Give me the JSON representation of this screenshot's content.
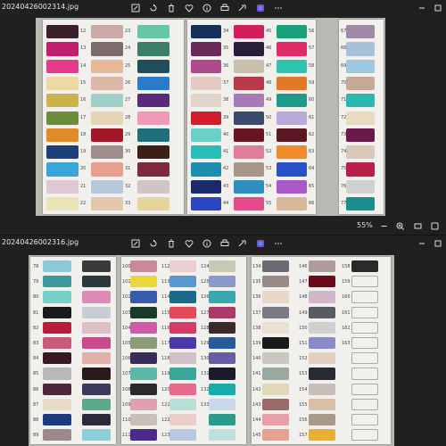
{
  "viewers": [
    {
      "filename": "20240426002314.jpg",
      "zoom": "55%",
      "toolbar_icons": [
        "edit-icon",
        "rotate-icon",
        "delete-icon",
        "favorite-icon",
        "info-icon",
        "print-icon",
        "share-icon",
        "copilot-icon",
        "more-icon"
      ],
      "cards": [
        {
          "columns": [
            {
              "numbers": [
                "12",
                "13",
                "14",
                "15",
                "16",
                "17",
                "18",
                "19",
                "20",
                "21",
                "22"
              ],
              "colors": [
                "#3a1f2c",
                "#c21e6e",
                "#e63a8c",
                "#ecd9a8",
                "#c9b34a",
                "#6c8e3a",
                "#e08a2a",
                "#1d3f7a",
                "#3aa6d8",
                "#dcc9d4",
                "#e9e4b5"
              ]
            },
            {
              "numbers": [
                "23",
                "24",
                "25",
                "26",
                "27",
                "28",
                "29",
                "30",
                "31",
                "32",
                "33"
              ],
              "colors": [
                "#caa9a6",
                "#7e6b6e",
                "#e9b79a",
                "#d9b8a8",
                "#9ed0c8",
                "#e6d3b6",
                "#a0182a",
                "#9e8f8a",
                "#e79f8f",
                "#b8c8d8",
                "#e0c8a8"
              ]
            },
            {
              "numbers": [
                "",
                "",
                "",
                "",
                "",
                "",
                "",
                "",
                "",
                "",
                ""
              ],
              "colors": [
                "#66c4a8",
                "#3b7f6a",
                "#1f4f5a",
                "#2a7cc8",
                "#5a2a7a",
                "#f09ab8",
                "#1e6f7a",
                "#3a2016",
                "#7a2a3a",
                "#cfc5c5",
                "#e6d59a"
              ]
            }
          ]
        },
        {
          "columns": [
            {
              "numbers": [
                "34",
                "35",
                "36",
                "37",
                "38",
                "39",
                "40",
                "41",
                "42",
                "43",
                "44"
              ],
              "colors": [
                "#14305a",
                "#6a2a5a",
                "#b04a8c",
                "#e4cbc2",
                "#e2d4cc",
                "#d01e2e",
                "#6ccfc8",
                "#2abcb6",
                "#1e8eb0",
                "#1a2a6a",
                "#2a46c0"
              ]
            },
            {
              "numbers": [
                "45",
                "46",
                "47",
                "48",
                "49",
                "50",
                "51",
                "52",
                "53",
                "54",
                "55"
              ],
              "colors": [
                "#d21e5a",
                "#2a1f3a",
                "#c8c0a8",
                "#b83a4a",
                "#a87ab8",
                "#3a4a6a",
                "#6a1622",
                "#e07e9a",
                "#a8968a",
                "#2e8ec0",
                "#e54a8a"
              ]
            },
            {
              "numbers": [
                "56",
                "57",
                "58",
                "59",
                "60",
                "61",
                "62",
                "63",
                "64",
                "65",
                "66"
              ],
              "colors": [
                "#1aa07a",
                "#e02a6a",
                "#2ec4b0",
                "#e07a2a",
                "#1e9a8a",
                "#b8aad8",
                "#5a1822",
                "#f08a2a",
                "#2a50c8",
                "#a858c8",
                "#d8b898"
              ]
            }
          ]
        },
        {
          "columns": [
            {
              "numbers": [
                "67",
                "68",
                "69",
                "70",
                "71",
                "72",
                "73",
                "74",
                "75",
                "76",
                "77"
              ],
              "colors": [
                "#9e8aa6",
                "#a8c0d8",
                "#9ec8e0",
                "#c4a898",
                "#2ab8b0",
                "#e8dcc0",
                "#6a1a4a",
                "#d8c8b8",
                "#b81e4a",
                "#cfd0d0",
                "#1a8e8e"
              ]
            }
          ]
        }
      ]
    },
    {
      "filename": "20240426002316.jpg",
      "toolbar_icons": [
        "edit-icon",
        "rotate-icon",
        "delete-icon",
        "favorite-icon",
        "info-icon",
        "print-icon",
        "share-icon",
        "copilot-icon",
        "more-icon"
      ],
      "cards": [
        {
          "columns": [
            {
              "numbers": [
                "78",
                "79",
                "80",
                "81",
                "82",
                "83",
                "84",
                "85",
                "86",
                "87",
                "88",
                "89"
              ],
              "colors": [
                "#8ec8d4",
                "#3a9a9a",
                "#7ad0c8",
                "#1a1a1a",
                "#b81e3a",
                "#c85a7a",
                "#3a1a22",
                "#b8b8b8",
                "#4a2a3a",
                "#e8dcc8",
                "#1a3a7a",
                "#9a8a8a"
              ]
            },
            {
              "numbers": [
                "",
                "",
                "",
                "",
                "",
                "",
                "",
                "",
                "",
                "",
                "",
                ""
              ],
              "colors": [
                "#3a3a3a",
                "#2a3a3a",
                "#dc8ab8",
                "#c8cad4",
                "#e0c0c8",
                "#c84a8a",
                "#e0b0a8",
                "#2a1a1a",
                "#3a3a5a",
                "#5aaa8a",
                "#2a2a3a",
                "#8ad0d8"
              ]
            }
          ]
        },
        {
          "columns": [
            {
              "numbers": [
                "100",
                "101",
                "102",
                "103",
                "104",
                "105",
                "106",
                "107",
                "108",
                "109",
                "110",
                "111"
              ],
              "colors": [
                "#c88a9a",
                "#e8d83a",
                "#3a5aaa",
                "#1a3a2a",
                "#d05aaa",
                "#8a9a7a",
                "#3a2a5a",
                "#5ab8a8",
                "#2a2a2a",
                "#e0a0b0",
                "#c8c0b8",
                "#4a2a8a"
              ]
            },
            {
              "numbers": [
                "112",
                "113",
                "114",
                "115",
                "116",
                "117",
                "118",
                "119",
                "120",
                "121",
                "122",
                "123"
              ],
              "colors": [
                "#e8d0d0",
                "#5a9ad0",
                "#1a6a8a",
                "#e04a5a",
                "#d83a6a",
                "#4a3aa8",
                "#d0c0c8",
                "#3aa898",
                "#e86a8a",
                "#b8e0d8",
                "#e8d0c8",
                "#b8c8e0"
              ]
            },
            {
              "numbers": [
                "124",
                "125",
                "126",
                "127",
                "128",
                "129",
                "130",
                "131",
                "132",
                "133",
                "",
                ""
              ],
              "colors": [
                "#c8c8b8",
                "#8a9aca",
                "#3aa8aa",
                "#aa3a6a",
                "#3a2a2a",
                "#2a5a9a",
                "#6a5aa8",
                "#1a1a2a",
                "#1aaaa8",
                "#c8d8e8",
                "#2a9a8a",
                "#c0e0e0"
              ]
            }
          ]
        },
        {
          "columns": [
            {
              "numbers": [
                "134",
                "135",
                "136",
                "137",
                "138",
                "139",
                "140",
                "141",
                "142",
                "143",
                "144",
                "145"
              ],
              "colors": [
                "#6a6a72",
                "#9a8a8a",
                "#e8d8c8",
                "#7a7a84",
                "#e8e0d0",
                "#1a1a1a",
                "#c8c8c0",
                "#9aa8a0",
                "#e0d8b8",
                "#9a6a6a",
                "#e8a0a8",
                "#e8a090"
              ]
            },
            {
              "numbers": [
                "146",
                "147",
                "148",
                "149",
                "150",
                "151",
                "152",
                "153",
                "154",
                "155",
                "156",
                "157"
              ],
              "colors": [
                "#b09a9a",
                "#6a0a1a",
                "#d0b8c8",
                "#5a5a62",
                "#d0d0d0",
                "#8a8ac8",
                "#e0d0c0",
                "#2a2a32",
                "#c8c0b8",
                "#d8c0a8",
                "#a89a8a",
                "#e8b030"
              ]
            },
            {
              "numbers": [
                "158",
                "159",
                "160",
                "161",
                "162",
                "163",
                "",
                "",
                "",
                "",
                "",
                ""
              ],
              "colors": [
                "#2a2a2a",
                "",
                "",
                "",
                "",
                "",
                "",
                "",
                "",
                "",
                "",
                ""
              ]
            }
          ]
        }
      ]
    }
  ]
}
